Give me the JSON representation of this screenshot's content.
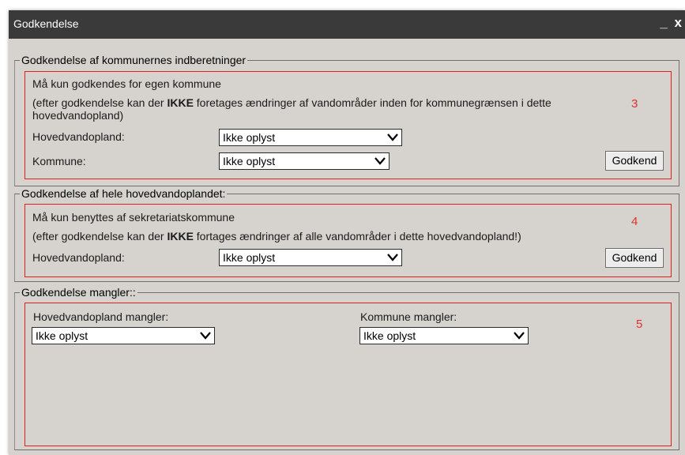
{
  "window": {
    "title": "Godkendelse",
    "minimize_label": "_",
    "close_label": "x"
  },
  "section1": {
    "legend": "Godkendelse af kommunernes indberetninger",
    "line1": "Må kun godkendes for egen kommune",
    "line2_pre": "(efter godkendelse kan der ",
    "line2_bold": "IKKE",
    "line2_post": " foretages ændringer af vandområder inden for kommunegrænsen i dette hovedvandopland)",
    "hoved_label": "Hovedvandopland:",
    "hoved_value": "Ikke oplyst",
    "kommune_label": "Kommune:",
    "kommune_value": "Ikke oplyst",
    "button_label": "Godkend",
    "annotation": "3"
  },
  "section2": {
    "legend": "Godkendelse af hele hovedvandoplandet:",
    "line1": "Må kun benyttes af sekretariatskommune",
    "line2_pre": "(efter godkendelse kan der ",
    "line2_bold": "IKKE",
    "line2_post": " fortages ændringer af alle vandområder i dette hovedvandopland!)",
    "hoved_label": "Hovedvandopland:",
    "hoved_value": "Ikke oplyst",
    "button_label": "Godkend",
    "annotation": "4"
  },
  "section3": {
    "legend": "Godkendelse mangler::",
    "hoved_label": "Hovedvandopland mangler:",
    "hoved_value": "Ikke oplyst",
    "kommune_label": "Kommune mangler:",
    "kommune_value": "Ikke oplyst",
    "annotation": "5"
  },
  "icons": {
    "dropdown": "chevron-down-icon"
  }
}
